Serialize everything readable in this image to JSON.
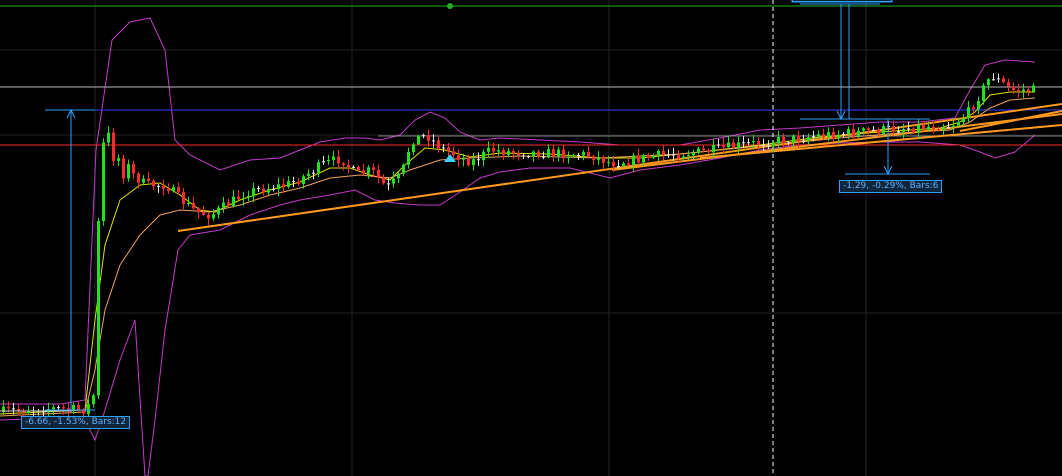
{
  "colors": {
    "background": "#000000",
    "grid": "#232323",
    "up_candle": "#22e022",
    "down_candle": "#ff2a2a",
    "neutral_candle": "#e8e8e8",
    "bollinger": "#c23cc8",
    "ma_fast": "#e0e000",
    "ma_slow": "#f0a060",
    "trendline": "#ff9a1e",
    "measure": "#2aa0ff",
    "support_line": "#ff2a2a",
    "resistance_line": "#3344ff",
    "level_line": "#b8b8b8",
    "top_line": "#22b022",
    "marker": "#3cd2ff",
    "label_text": "#5ab4ff",
    "label_bg": "#10243a"
  },
  "measurements": [
    {
      "text": "-6.66, -1.53%, Bars:12"
    },
    {
      "text": "-1.29, -0.29%, Bars:6"
    },
    {
      "text": ""
    }
  ],
  "markers": [
    {
      "icon": "up-triangle-icon"
    },
    {
      "icon": "green-dot-icon"
    }
  ]
}
